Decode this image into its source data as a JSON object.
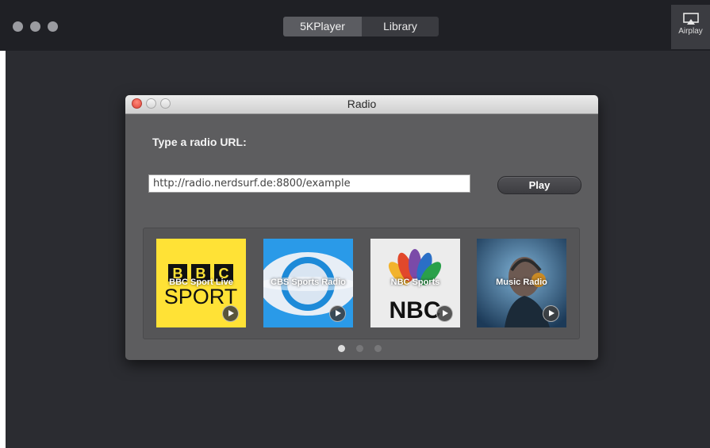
{
  "window": {
    "tabs": [
      {
        "label": "5KPlayer",
        "active": true
      },
      {
        "label": "Library",
        "active": false
      }
    ],
    "airplay_label": "Airplay"
  },
  "dialog": {
    "title": "Radio",
    "url_prompt": "Type a radio URL:",
    "url_value": "http://radio.nerdsurf.de:8800/example",
    "play_label": "Play",
    "stations": [
      {
        "label": "BBC Sport Live",
        "logo_text_top": "BBC",
        "logo_text_bottom": "SPORT"
      },
      {
        "label": "CBS Sports Radio"
      },
      {
        "label": "NBC Sports",
        "logo_text": "NBC"
      },
      {
        "label": "Music Radio"
      }
    ],
    "pager": {
      "pages": 3,
      "current": 1
    }
  },
  "colors": {
    "titlebar_bg": "#1f2025",
    "main_bg": "#2b2c31",
    "dialog_bg": "#5d5d5f",
    "bbc_yellow": "#ffe236",
    "cbs_blue": "#1a8fe0"
  }
}
